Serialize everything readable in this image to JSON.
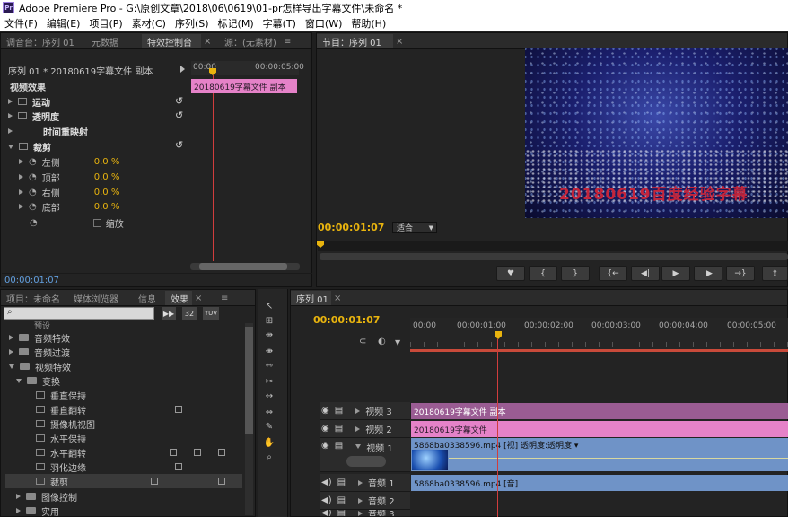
{
  "window": {
    "app_icon": "Pr",
    "title": "Adobe Premiere Pro - G:\\原创文章\\2018\\06\\0619\\01-pr怎样导出字幕文件\\未命名 *"
  },
  "menu": [
    "文件(F)",
    "编辑(E)",
    "项目(P)",
    "素材(C)",
    "序列(S)",
    "标记(M)",
    "字幕(T)",
    "窗口(W)",
    "帮助(H)"
  ],
  "top_left_tabs": [
    "调音台：序列 01",
    "元数据",
    "特效控制台",
    "源：(无素材)"
  ],
  "effect_controls": {
    "header": "序列 01 * 20180619字幕文件 副本",
    "ruler_start": "00:00",
    "ruler_end": "00:00:05:00",
    "clip_name": "20180619字幕文件 副本",
    "section": "视频效果",
    "effects": [
      "运动",
      "透明度",
      "时间重映射",
      "裁剪"
    ],
    "params": [
      {
        "name": "左侧",
        "value": "0.0 %"
      },
      {
        "name": "顶部",
        "value": "0.0 %"
      },
      {
        "name": "右侧",
        "value": "0.0 %"
      },
      {
        "name": "底部",
        "value": "0.0 %"
      }
    ],
    "zoom_label": "缩放",
    "timecode": "00:00:01:07"
  },
  "program": {
    "tab": "节目：序列 01",
    "timecode": "00:00:01:07",
    "fit": "适合",
    "preview_text": "20180619百度经验字幕"
  },
  "project_tabs": [
    "项目：未命名",
    "媒体浏览器",
    "信息",
    "效果"
  ],
  "effects_panel": {
    "badges": [
      "32",
      "YUV"
    ],
    "top_cut": "预设",
    "items": [
      {
        "label": "音频特效",
        "type": "folder",
        "level": 0
      },
      {
        "label": "音频过渡",
        "type": "folder",
        "level": 0
      },
      {
        "label": "视频特效",
        "type": "folder-open",
        "level": 0
      },
      {
        "label": "变换",
        "type": "folder-open",
        "level": 1
      },
      {
        "label": "垂直保持",
        "type": "fx",
        "level": 2
      },
      {
        "label": "垂直翻转",
        "type": "fx",
        "level": 2
      },
      {
        "label": "摄像机视图",
        "type": "fx",
        "level": 2
      },
      {
        "label": "水平保持",
        "type": "fx",
        "level": 2
      },
      {
        "label": "水平翻转",
        "type": "fx",
        "level": 2
      },
      {
        "label": "羽化边缘",
        "type": "fx",
        "level": 2
      },
      {
        "label": "裁剪",
        "type": "fx",
        "level": 2
      },
      {
        "label": "图像控制",
        "type": "folder",
        "level": 1
      },
      {
        "label": "实用",
        "type": "folder",
        "level": 1
      }
    ]
  },
  "sequence": {
    "tab": "序列 01",
    "timecode": "00:00:01:07",
    "ruler": [
      "00:00",
      "00:00:01:00",
      "00:00:02:00",
      "00:00:03:00",
      "00:00:04:00",
      "00:00:05:00"
    ],
    "tracks": [
      {
        "name": "视频 3",
        "clip": "20180619字幕文件 副本"
      },
      {
        "name": "视频 2",
        "clip": "20180619字幕文件"
      },
      {
        "name": "视频 1",
        "clip": "5868ba0338596.mp4 [视] 透明度:透明度 ▾"
      },
      {
        "name": "音频 1",
        "clip": "5868ba0338596.mp4 [音]"
      },
      {
        "name": "音频 2",
        "clip": ""
      },
      {
        "name": "音频 3",
        "clip": ""
      }
    ]
  },
  "colors": {
    "accent": "#e9b40e",
    "title_clip": "#e582c8",
    "video_clip": "#6f93c7",
    "playhead": "#d13d3d"
  }
}
